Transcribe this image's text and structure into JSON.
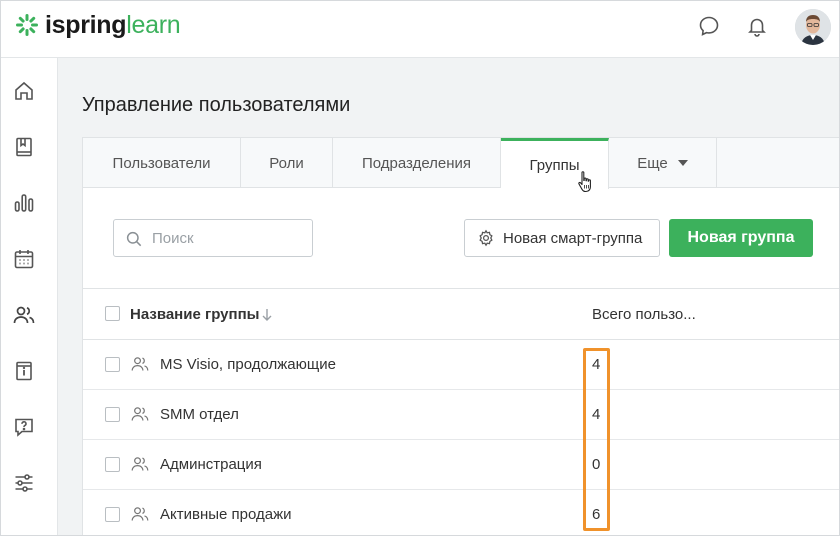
{
  "app": {
    "logo_part1": "ispring",
    "logo_part2": "learn",
    "brand_color": "#3cb15c",
    "accent_highlight": "#f0922b"
  },
  "header": {
    "icons": [
      "chat-icon",
      "bell-icon",
      "avatar"
    ]
  },
  "sidebar": {
    "items": [
      {
        "icon": "home-icon"
      },
      {
        "icon": "book-icon"
      },
      {
        "icon": "reports-icon"
      },
      {
        "icon": "calendar-icon"
      },
      {
        "icon": "users-icon"
      },
      {
        "icon": "info-book-icon"
      },
      {
        "icon": "help-icon"
      },
      {
        "icon": "settings-sliders-icon"
      }
    ]
  },
  "page": {
    "title": "Управление пользователями"
  },
  "tabs": [
    {
      "label": "Пользователи"
    },
    {
      "label": "Роли"
    },
    {
      "label": "Подразделения"
    },
    {
      "label": "Группы",
      "active": true
    },
    {
      "label": "Еще"
    }
  ],
  "toolbar": {
    "search_placeholder": "Поиск",
    "smart_group_label": "Новая смарт-группа",
    "new_group_label": "Новая группа"
  },
  "table": {
    "columns": {
      "name": "Название группы",
      "total": "Всего пользо..."
    },
    "rows": [
      {
        "name": "MS Visio, продолжающие",
        "count": "4"
      },
      {
        "name": "SMM отдел",
        "count": "4"
      },
      {
        "name": "Админстрация",
        "count": "0"
      },
      {
        "name": "Активные продажи",
        "count": "6"
      }
    ]
  }
}
